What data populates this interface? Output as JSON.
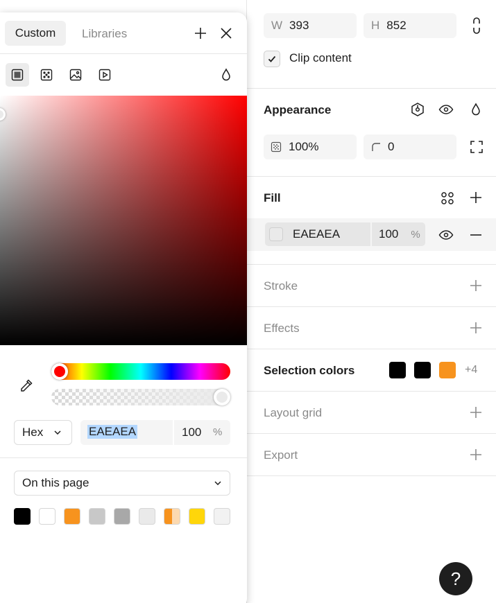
{
  "properties": {
    "width": {
      "prefix": "W",
      "value": "393"
    },
    "height": {
      "prefix": "H",
      "value": "852"
    },
    "clip_content": {
      "label": "Clip content",
      "checked": true
    },
    "appearance": {
      "title": "Appearance",
      "opacity": "100%",
      "corner_radius": "0"
    },
    "fill": {
      "title": "Fill",
      "hex": "EAEAEA",
      "opacity": "100",
      "percent": "%",
      "swatch_color": "#eaeaea"
    },
    "stroke": {
      "title": "Stroke"
    },
    "effects": {
      "title": "Effects"
    },
    "selection_colors": {
      "title": "Selection colors",
      "colors": [
        "#000000",
        "#000000",
        "#f7931e"
      ],
      "more": "+4"
    },
    "layout_grid": {
      "title": "Layout grid"
    },
    "export": {
      "title": "Export"
    },
    "help": {
      "label": "?"
    }
  },
  "picker": {
    "tabs": {
      "custom": "Custom",
      "libraries": "Libraries"
    },
    "paint_types": [
      "solid-paint-icon",
      "gradient-paint-icon",
      "image-paint-icon",
      "video-paint-icon"
    ],
    "hue_color": "#ff0000",
    "mode": "Hex",
    "hex": "EAEAEA",
    "opacity": "100",
    "percent": "%",
    "scope": "On this page",
    "doc_colors": [
      "#000000",
      "#ffffff",
      "#f7931e",
      "#c8c8c8",
      "#a8a8a8",
      "#eaeaea",
      "#f7931e",
      "#ffd60a",
      "#f2f2f2"
    ]
  }
}
